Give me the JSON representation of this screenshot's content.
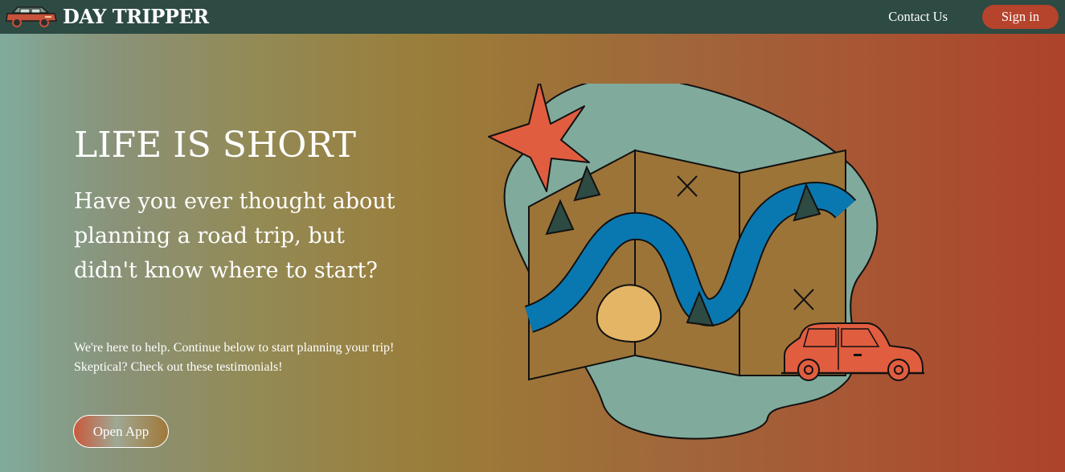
{
  "navbar": {
    "logo_icon": "car-logo-icon",
    "brand": "DAY TRIPPER",
    "contact_link": "Contact Us",
    "signin_button": "Sign in"
  },
  "hero": {
    "title": "LIFE IS SHORT",
    "subtitle": "Have you ever thought about planning a road trip, but didn't know where to start?",
    "description": "We're here to help. Continue below to start planning your trip! Skeptical? Check out these testimonials!",
    "cta_button": "Open App",
    "illustration_icon": "map-with-car-illustration"
  },
  "colors": {
    "navbar_bg": "#2d4a43",
    "accent": "#b6432c",
    "teal": "#80ab9c",
    "ochre": "#9d7438",
    "river": "#0a78b0",
    "car": "#e05d3f"
  }
}
